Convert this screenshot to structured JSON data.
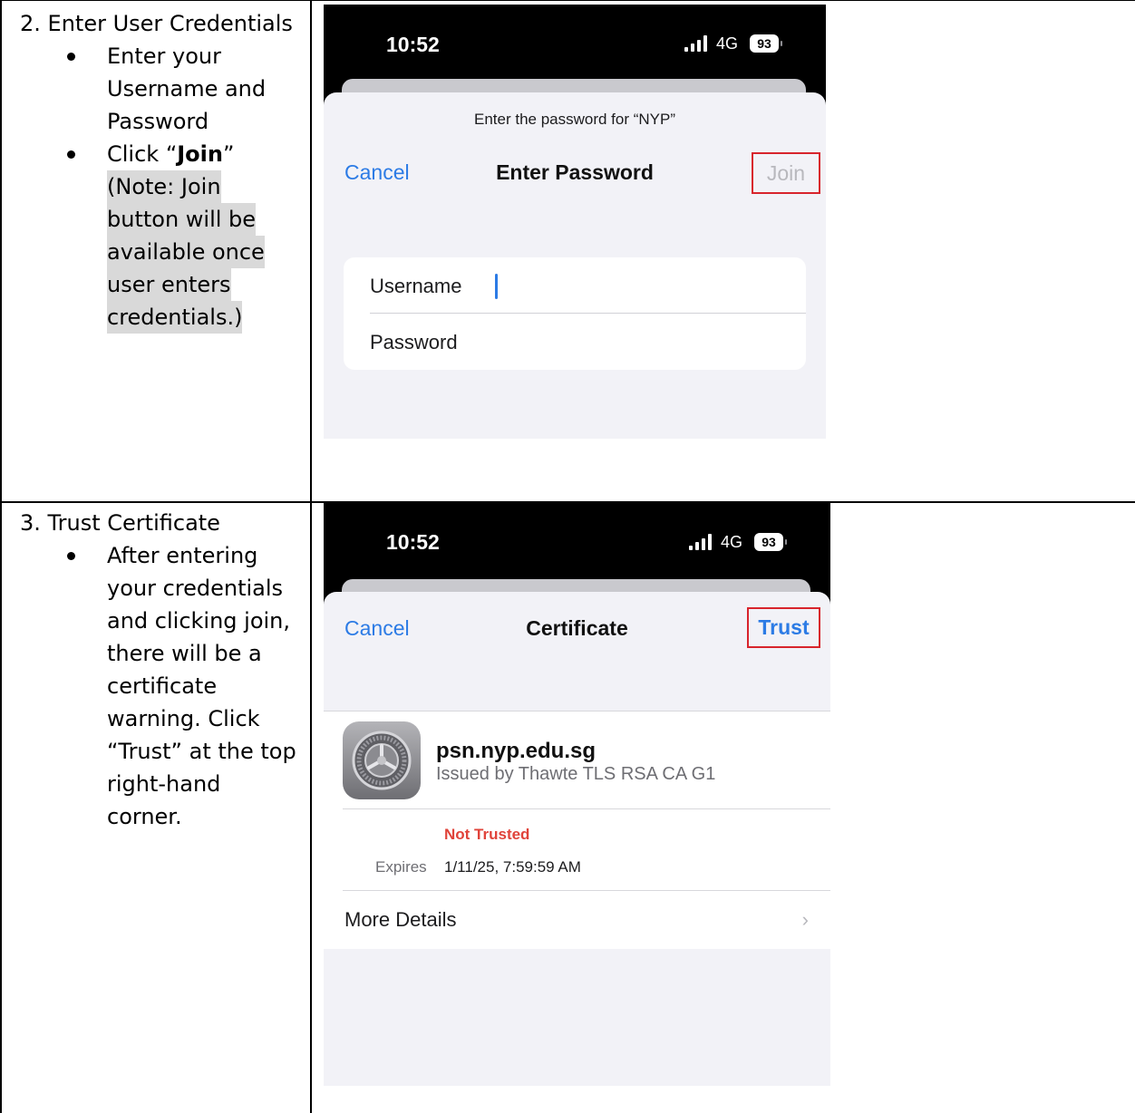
{
  "steps": [
    {
      "title": "2. Enter User Credentials",
      "bullets": {
        "b1_lines": [
          "Enter your",
          "Username and",
          "Password"
        ],
        "b2_prefix": "Click “",
        "b2_bold": "Join",
        "b2_suffix": "”",
        "note_lines": [
          "(Note: Join",
          "button will be",
          "available once",
          "user enters",
          "credentials.)"
        ]
      },
      "phone": {
        "time": "10:52",
        "network": "4G",
        "battery": "93",
        "prompt": "Enter the password for “NYP”",
        "cancel": "Cancel",
        "title": "Enter Password",
        "action": "Join",
        "username_label": "Username",
        "password_label": "Password"
      }
    },
    {
      "title": "3. Trust Certificate",
      "bullet_lines": [
        "After entering",
        "your credentials",
        "and clicking join,",
        "there will be a",
        "certificate",
        "warning. Click",
        "“Trust” at the top",
        "right-hand",
        "corner."
      ],
      "phone": {
        "time": "10:52",
        "network": "4G",
        "battery": "93",
        "cancel": "Cancel",
        "title": "Certificate",
        "action": "Trust",
        "cert_name": "psn.nyp.edu.sg",
        "cert_issuer": "Issued by Thawte TLS RSA CA G1",
        "status": "Not Trusted",
        "expires_label": "Expires",
        "expires_value": "1/11/25, 7:59:59 AM",
        "more_details": "More Details",
        "chevron": "›"
      }
    }
  ],
  "colors": {
    "ios_blue": "#2c7be5",
    "highlight_box": "#d8242c",
    "not_trusted": "#e0433a",
    "note_highlight": "#d9d9d9"
  },
  "icons": [
    "signal-bars-icon",
    "battery-icon",
    "settings-gear-icon",
    "chevron-right-icon"
  ]
}
